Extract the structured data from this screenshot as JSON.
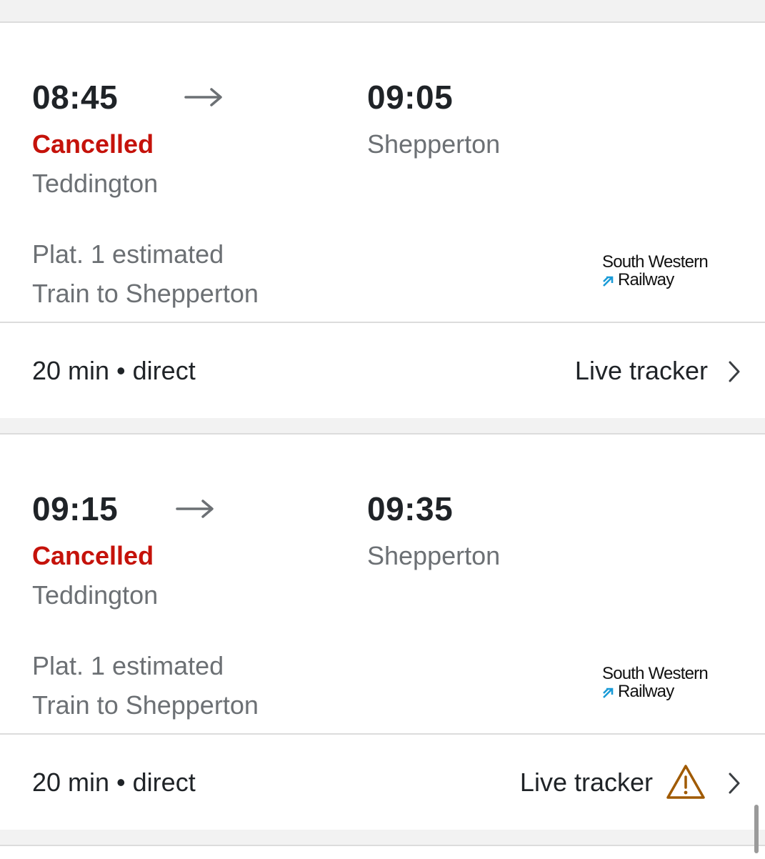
{
  "journeys": [
    {
      "departure_time": "08:45",
      "arrival_time": "09:05",
      "status": "Cancelled",
      "origin": "Teddington",
      "destination": "Shepperton",
      "platform": "Plat. 1 estimated",
      "service": "Train to Shepperton",
      "operator_line1": "South Western",
      "operator_line2": "Railway",
      "duration": "20 min • direct",
      "tracker_label": "Live tracker",
      "has_warning": false
    },
    {
      "departure_time": "09:15",
      "arrival_time": "09:35",
      "status": "Cancelled",
      "origin": "Teddington",
      "destination": "Shepperton",
      "platform": "Plat. 1 estimated",
      "service": "Train to Shepperton",
      "operator_line1": "South Western",
      "operator_line2": "Railway",
      "duration": "20 min • direct",
      "tracker_label": "Live tracker",
      "has_warning": true
    }
  ],
  "icons": {
    "arrow": "arrow-right-icon",
    "chevron": "chevron-right-icon",
    "warning": "warning-triangle-icon",
    "operator_mark": "swr-arrow-mark"
  },
  "colors": {
    "cancelled": "#c5120a",
    "primary_text": "#1f2327",
    "secondary_text": "#6c7074",
    "warning": "#a05a00",
    "operator_accent": "#1a9bd7"
  }
}
